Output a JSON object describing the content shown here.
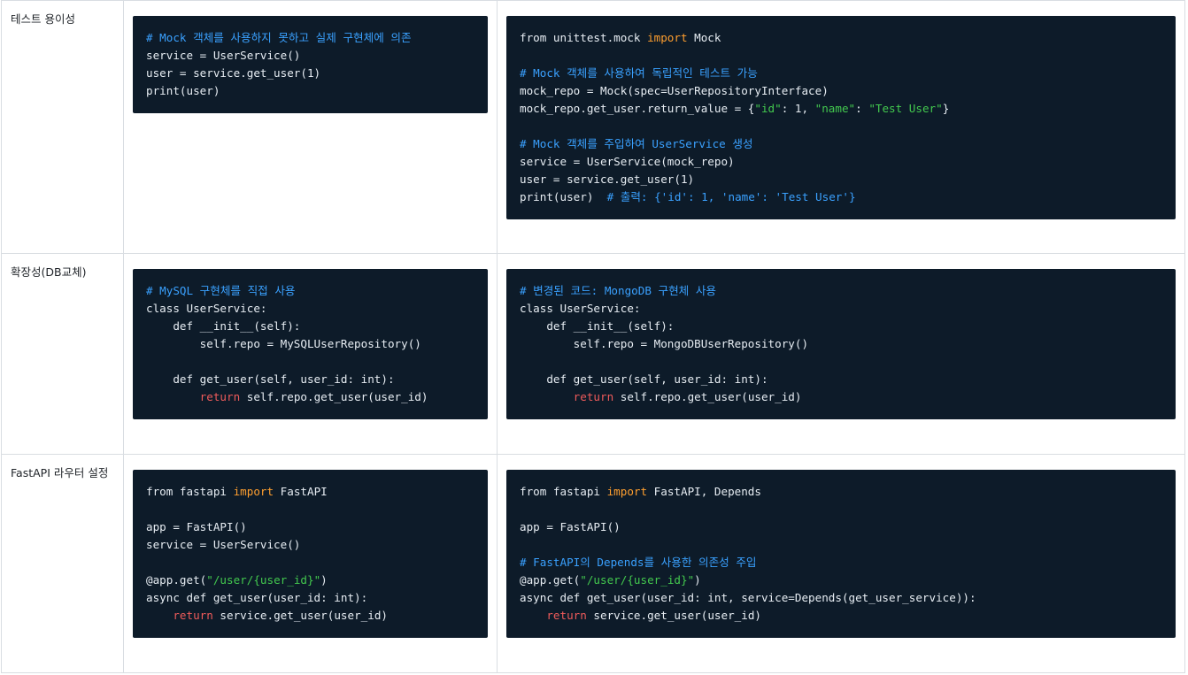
{
  "rows": [
    {
      "label": "테스트 용이성",
      "left": [
        [
          {
            "t": "# Mock 객체를 사용하지 못하고 실제 구현체에 의존",
            "c": "c"
          }
        ],
        [
          {
            "t": "service = UserService()"
          }
        ],
        [
          {
            "t": "user = service.get_user(1)"
          }
        ],
        [
          {
            "t": "print(user)"
          }
        ]
      ],
      "right": [
        [
          {
            "t": "from unittest.mock "
          },
          {
            "t": "import",
            "c": "k"
          },
          {
            "t": " Mock"
          }
        ],
        [],
        [
          {
            "t": "# Mock 객체를 사용하여 독립적인 테스트 가능",
            "c": "c"
          }
        ],
        [
          {
            "t": "mock_repo = Mock(spec=UserRepositoryInterface)"
          }
        ],
        [
          {
            "t": "mock_repo.get_user.return_value = {"
          },
          {
            "t": "\"id\"",
            "c": "s"
          },
          {
            "t": ": 1, "
          },
          {
            "t": "\"name\"",
            "c": "s"
          },
          {
            "t": ": "
          },
          {
            "t": "\"Test User\"",
            "c": "s"
          },
          {
            "t": "}"
          }
        ],
        [],
        [
          {
            "t": "# Mock 객체를 주입하여 UserService 생성",
            "c": "c"
          }
        ],
        [
          {
            "t": "service = UserService(mock_repo)"
          }
        ],
        [
          {
            "t": "user = service.get_user(1)"
          }
        ],
        [
          {
            "t": "print(user)  "
          },
          {
            "t": "# 출력: {'id': 1, 'name': 'Test User'}",
            "c": "c"
          }
        ]
      ]
    },
    {
      "label": "확장성(DB교체)",
      "left": [
        [
          {
            "t": "# MySQL 구현체를 직접 사용",
            "c": "c"
          }
        ],
        [
          {
            "t": "class UserService:"
          }
        ],
        [
          {
            "t": "    def __init__(self):"
          }
        ],
        [
          {
            "t": "        self.repo = MySQLUserRepository()"
          }
        ],
        [],
        [
          {
            "t": "    def get_user(self, user_id: int):"
          }
        ],
        [
          {
            "t": "        "
          },
          {
            "t": "return",
            "c": "r"
          },
          {
            "t": " self.repo.get_user(user_id)"
          }
        ]
      ],
      "right": [
        [
          {
            "t": "# 변경된 코드: MongoDB 구현체 사용",
            "c": "c"
          }
        ],
        [
          {
            "t": "class UserService:"
          }
        ],
        [
          {
            "t": "    def __init__(self):"
          }
        ],
        [
          {
            "t": "        self.repo = MongoDBUserRepository()"
          }
        ],
        [],
        [
          {
            "t": "    def get_user(self, user_id: int):"
          }
        ],
        [
          {
            "t": "        "
          },
          {
            "t": "return",
            "c": "r"
          },
          {
            "t": " self.repo.get_user(user_id)"
          }
        ]
      ]
    },
    {
      "label": "FastAPI 라우터 설정",
      "left": [
        [
          {
            "t": "from fastapi "
          },
          {
            "t": "import",
            "c": "k"
          },
          {
            "t": " FastAPI"
          }
        ],
        [],
        [
          {
            "t": "app = FastAPI()"
          }
        ],
        [
          {
            "t": "service = UserService()"
          }
        ],
        [],
        [
          {
            "t": "@app.get("
          },
          {
            "t": "\"/user/{user_id}\"",
            "c": "s"
          },
          {
            "t": ")"
          }
        ],
        [
          {
            "t": "async def get_user(user_id: int):"
          }
        ],
        [
          {
            "t": "    "
          },
          {
            "t": "return",
            "c": "r"
          },
          {
            "t": " service.get_user(user_id)"
          }
        ]
      ],
      "right": [
        [
          {
            "t": "from fastapi "
          },
          {
            "t": "import",
            "c": "k"
          },
          {
            "t": " FastAPI, Depends"
          }
        ],
        [],
        [
          {
            "t": "app = FastAPI()"
          }
        ],
        [],
        [
          {
            "t": "# FastAPI의 Depends를 사용한 의존성 주입",
            "c": "c"
          }
        ],
        [
          {
            "t": "@app.get("
          },
          {
            "t": "\"/user/{user_id}\"",
            "c": "s"
          },
          {
            "t": ")"
          }
        ],
        [
          {
            "t": "async def get_user(user_id: int, service=Depends(get_user_service)):"
          }
        ],
        [
          {
            "t": "    "
          },
          {
            "t": "return",
            "c": "r"
          },
          {
            "t": " service.get_user(user_id)"
          }
        ]
      ]
    }
  ]
}
